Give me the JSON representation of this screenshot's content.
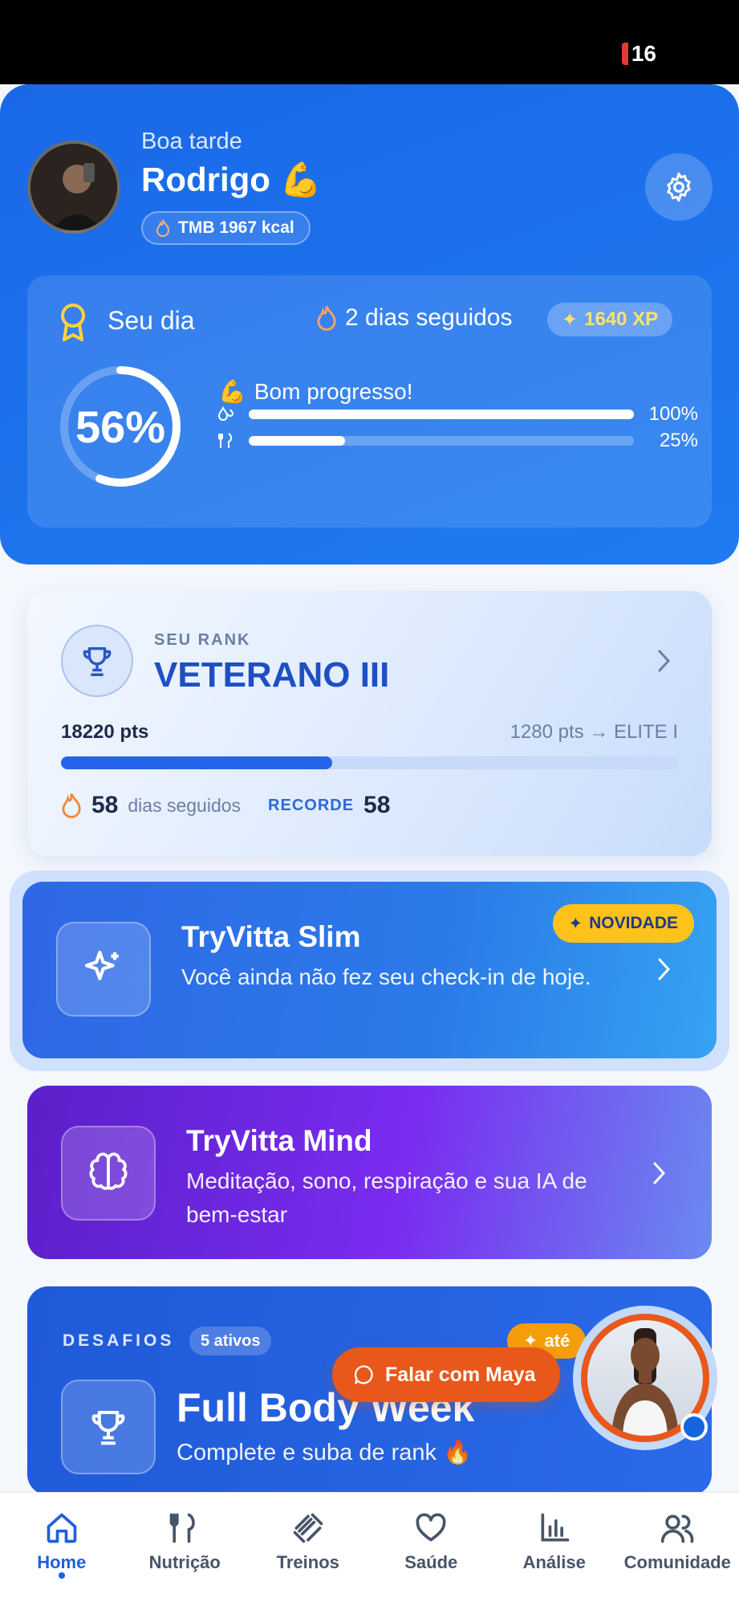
{
  "status_bar": {
    "battery": "16"
  },
  "header": {
    "greeting": "Boa tarde",
    "name": "Rodrigo 💪",
    "tmb": "TMB 1967 kcal"
  },
  "day": {
    "title": "Seu dia",
    "streak": "2 dias seguidos",
    "xp": "1640 XP",
    "percent_label": "56%",
    "percent": 56,
    "message": "Bom progresso!",
    "bars": [
      {
        "icon": "water-drops-icon",
        "value": 100,
        "label": "100%"
      },
      {
        "icon": "utensils-icon",
        "value": 25,
        "label": "25%"
      }
    ]
  },
  "rank": {
    "label": "SEU RANK",
    "name": "VETERANO III",
    "points": "18220 pts",
    "next": "1280 pts → ELITE I",
    "progress": 0.44,
    "streak_days": "58",
    "streak_label": "dias seguidos",
    "record_label": "RECORDE",
    "record_value": "58"
  },
  "slim": {
    "badge": "NOVIDADE",
    "title": "TryVitta Slim",
    "subtitle": "Você ainda não fez seu check-in de hoje."
  },
  "mind": {
    "title": "TryVitta Mind",
    "subtitle": "Meditação, sono, respiração e sua IA de bem-estar"
  },
  "challenges": {
    "label": "DESAFIOS",
    "count": "5 ativos",
    "tag": "até",
    "title": "Full Body Week",
    "subtitle": "Complete e suba de rank 🔥"
  },
  "maya": {
    "button": "Falar com Maya"
  },
  "tabs": [
    {
      "label": "Home",
      "icon": "home-icon",
      "active": true
    },
    {
      "label": "Nutrição",
      "icon": "utensils-icon"
    },
    {
      "label": "Treinos",
      "icon": "dumbbell-icon"
    },
    {
      "label": "Saúde",
      "icon": "heart-icon"
    },
    {
      "label": "Análise",
      "icon": "bar-chart-icon"
    },
    {
      "label": "Comunidade",
      "icon": "users-icon"
    }
  ],
  "colors": {
    "primary": "#1f6fea",
    "accent_orange": "#e8581a",
    "badge_yellow": "#ffc21a",
    "mind_purple": "#7a2cf0"
  }
}
